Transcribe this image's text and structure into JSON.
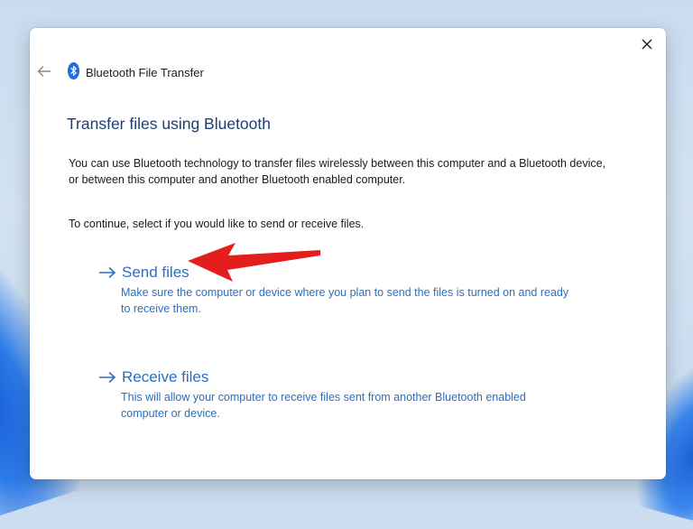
{
  "window": {
    "title": "Bluetooth File Transfer"
  },
  "page": {
    "heading": "Transfer files using Bluetooth",
    "intro": "You can use Bluetooth technology to transfer files wirelessly between this computer and a Bluetooth device, or between this computer and another Bluetooth enabled computer.",
    "instruction": "To continue, select if you would like to send or receive files."
  },
  "options": [
    {
      "label": "Send files",
      "description": "Make sure the computer or device where you plan to send the files is turned on and ready to receive them."
    },
    {
      "label": "Receive files",
      "description": "This will allow your computer to receive files sent from another Bluetooth enabled computer or device."
    }
  ],
  "icons": {
    "back": "back-arrow-icon",
    "close": "close-icon",
    "bluetooth": "bluetooth-icon",
    "option_arrow": "arrow-right-icon",
    "annotation": "red-pointer-arrow-icon"
  },
  "colors": {
    "heading": "#1e3f74",
    "link": "#2a6fc2",
    "bluetooth": "#1e6fd9",
    "annotation": "#e41d1d"
  }
}
